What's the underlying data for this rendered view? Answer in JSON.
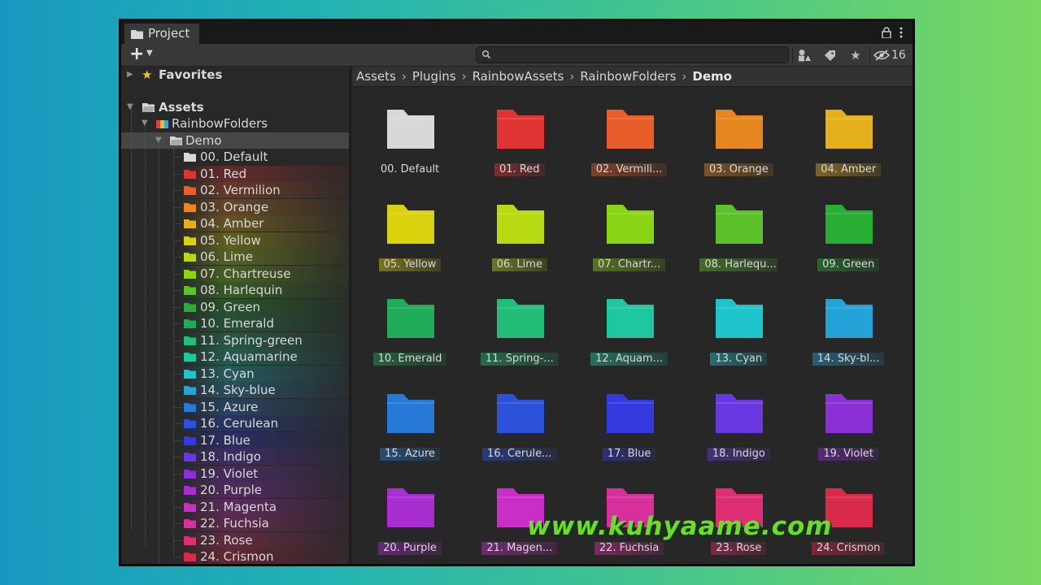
{
  "window": {
    "tab_label": "Project",
    "hidden_count": "16"
  },
  "search": {
    "placeholder": "",
    "value": ""
  },
  "sidebar": {
    "favorites_label": "Favorites",
    "assets_label": "Assets",
    "plugin_folder": "RainbowFolders",
    "demo_folder": "Demo"
  },
  "breadcrumb": [
    "Assets",
    "Plugins",
    "RainbowAssets",
    "RainbowFolders",
    "Demo"
  ],
  "folders": [
    {
      "name": "00. Default",
      "short": "00. Default",
      "color": "#d8d8d8"
    },
    {
      "name": "01. Red",
      "short": "01. Red",
      "color": "#e03434"
    },
    {
      "name": "02. Vermilion",
      "short": "02. Vermili...",
      "color": "#e85d2a"
    },
    {
      "name": "03. Orange",
      "short": "03. Orange",
      "color": "#e6861f"
    },
    {
      "name": "04. Amber",
      "short": "04. Amber",
      "color": "#e4b11c"
    },
    {
      "name": "05. Yellow",
      "short": "05. Yellow",
      "color": "#dbd20e"
    },
    {
      "name": "06. Lime",
      "short": "06. Lime",
      "color": "#b8da12"
    },
    {
      "name": "07. Chartreuse",
      "short": "07. Chartr...",
      "color": "#8ad416"
    },
    {
      "name": "08. Harlequin",
      "short": "08. Harlequ...",
      "color": "#5bc229"
    },
    {
      "name": "09. Green",
      "short": "09. Green",
      "color": "#28ad35"
    },
    {
      "name": "10. Emerald",
      "short": "10. Emerald",
      "color": "#1fab57"
    },
    {
      "name": "11. Spring-green",
      "short": "11. Spring-...",
      "color": "#22bd78"
    },
    {
      "name": "12. Aquamarine",
      "short": "12. Aquam...",
      "color": "#1fc7a0"
    },
    {
      "name": "13. Cyan",
      "short": "13. Cyan",
      "color": "#1fc5cc"
    },
    {
      "name": "14. Sky-blue",
      "short": "14. Sky-bl...",
      "color": "#23a3d8"
    },
    {
      "name": "15. Azure",
      "short": "15. Azure",
      "color": "#2679d6"
    },
    {
      "name": "16. Cerulean",
      "short": "16. Cerule...",
      "color": "#2b52d8"
    },
    {
      "name": "17. Blue",
      "short": "17. Blue",
      "color": "#3439e0"
    },
    {
      "name": "18. Indigo",
      "short": "18. Indigo",
      "color": "#6a38e0"
    },
    {
      "name": "19. Violet",
      "short": "19. Violet",
      "color": "#8a30d6"
    },
    {
      "name": "20. Purple",
      "short": "20. Purple",
      "color": "#a82ed0"
    },
    {
      "name": "21. Magenta",
      "short": "21. Magen...",
      "color": "#c92fc6"
    },
    {
      "name": "22. Fuchsia",
      "short": "22. Fuchsia",
      "color": "#d7309c"
    },
    {
      "name": "23. Rose",
      "short": "23. Rose",
      "color": "#dd2e72"
    },
    {
      "name": "24. Crismon",
      "short": "24. Crismon",
      "color": "#d92a4a"
    }
  ],
  "colors": {
    "star": "#f2c12e",
    "default_folder": "#d8d8d8"
  },
  "watermark": "www.kuhyaame.com"
}
